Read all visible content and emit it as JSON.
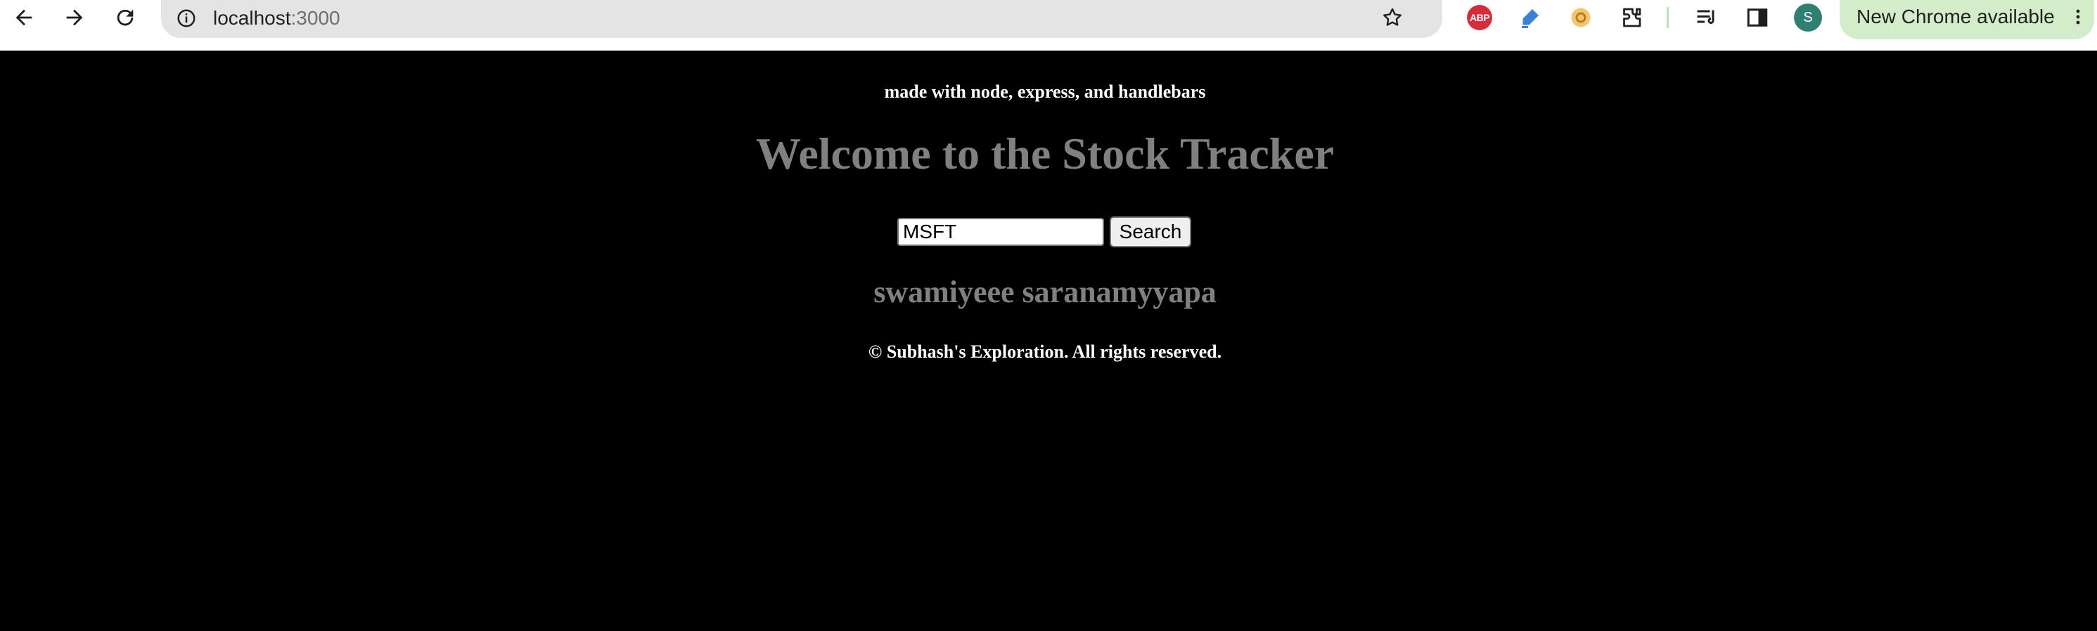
{
  "browser": {
    "url_host": "localhost",
    "url_port": ":3000",
    "profile_initial": "S",
    "abp_label": "ABP",
    "update_label": "New Chrome available",
    "icons": [
      "back-icon",
      "forward-icon",
      "reload-icon",
      "site-info-icon",
      "bookmark-star-icon",
      "adblock-plus-icon",
      "highlighter-icon",
      "bitwarden-like-icon",
      "extensions-puzzle-icon",
      "reading-list-icon",
      "side-panel-icon",
      "kebab-menu-icon"
    ],
    "colors": {
      "toolbar": "#ffffff",
      "omnibox": "#e4e4e4",
      "update_chip": "#d3ecc9",
      "avatar": "#2f7f73"
    }
  },
  "page": {
    "made_with": "made with node, express, and handlebars",
    "title": "Welcome to the Stock Tracker",
    "search": {
      "value": "MSFT",
      "button_label": "Search"
    },
    "result": "swamiyeee saranamyyapa",
    "footer": "© Subhash's Exploration. All rights reserved.",
    "colors": {
      "background": "#000000",
      "heading": "#808080",
      "text": "#ffffff"
    }
  }
}
